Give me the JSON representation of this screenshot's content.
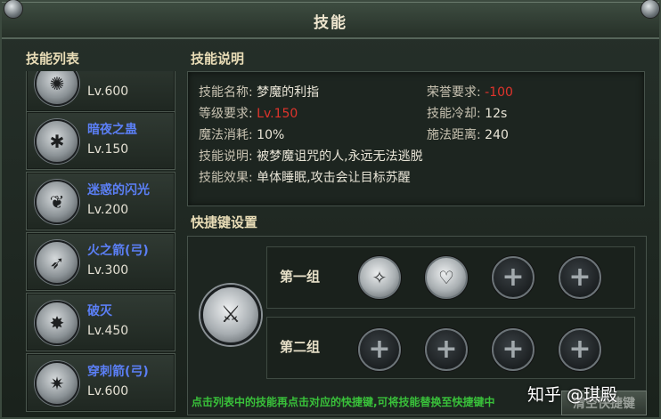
{
  "window": {
    "title": "技能"
  },
  "skill_list": {
    "heading": "技能列表",
    "items": [
      {
        "name": "",
        "level": "Lv.600",
        "icon": "swirl-icon"
      },
      {
        "name": "暗夜之蛊",
        "level": "Lv.150",
        "icon": "insect-icon"
      },
      {
        "name": "迷惑的闪光",
        "level": "Lv.200",
        "icon": "wing-icon"
      },
      {
        "name": "火之箭(弓)",
        "level": "Lv.300",
        "icon": "fire-arrow-icon"
      },
      {
        "name": "破灭",
        "level": "Lv.450",
        "icon": "burst-icon"
      },
      {
        "name": "穿刺箭(弓)",
        "level": "Lv.600",
        "icon": "pierce-arrow-icon"
      }
    ]
  },
  "description": {
    "heading": "技能说明",
    "name_label": "技能名称:",
    "name_value": "梦魔的利指",
    "honor_label": "荣誉要求:",
    "honor_value": "-100",
    "level_label": "等级要求:",
    "level_value": "Lv.150",
    "cooldown_label": "技能冷却:",
    "cooldown_value": "12s",
    "mana_label": "魔法消耗:",
    "mana_value": "10%",
    "range_label": "施法距离:",
    "range_value": "240",
    "desc_label": "技能说明:",
    "desc_value": "被梦魔诅咒的人,永远无法逃脱",
    "effect_label": "技能效果:",
    "effect_value": "单体睡眠,攻击会让目标苏醒"
  },
  "shortcuts": {
    "heading": "快捷键设置",
    "group1_label": "第一组",
    "group2_label": "第二组",
    "hint": "点击列表中的技能再点击对应的快捷键,可将技能替换至快捷键中",
    "clear_button": "清空快捷键",
    "plus_glyph": "+"
  },
  "watermark": "知乎 @琪殿",
  "colors": {
    "skill_name": "#5b7ff5",
    "requirement": "#e0342c",
    "hint": "#39c13a"
  }
}
